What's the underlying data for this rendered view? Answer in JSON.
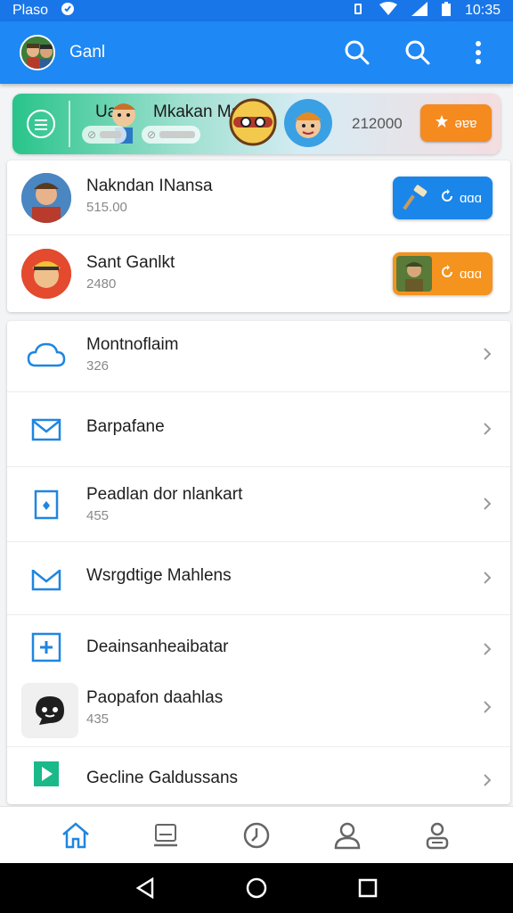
{
  "status_bar": {
    "carrier": "Plaso",
    "time": "10:35"
  },
  "app_bar": {
    "title": "Ganl",
    "icons": [
      "search-icon",
      "search-icon",
      "more-vert-icon"
    ]
  },
  "banner": {
    "title": "Mkakan Ma",
    "title_prefix": "Ua",
    "chip1": "⊘",
    "chip2": "⊘",
    "amount": "212000",
    "button_label": "ǝɐɐ",
    "button_icon": "star-icon"
  },
  "featured": [
    {
      "title": "Nakndan INansa",
      "subtitle": "515.00",
      "button_label": "ɑɑɑ",
      "button_color": "#1a86ea"
    },
    {
      "title": "Sant Ganlkt",
      "subtitle": "2480",
      "button_label": "ɑɑɑ",
      "button_color": "#f4931e"
    }
  ],
  "list": [
    {
      "title": "Montnoflaim",
      "subtitle": "326",
      "icon": "cloud-icon"
    },
    {
      "title": "Barpafane",
      "subtitle": "",
      "icon": "mail-icon"
    },
    {
      "title": "Peadlan dor nlankart",
      "subtitle": "455",
      "icon": "file-icon"
    },
    {
      "title": "Wsrgdtige Mahlens",
      "subtitle": "",
      "icon": "mail-icon"
    },
    {
      "title": "Deainsanheaibatar",
      "subtitle": "",
      "icon": "plus-box-icon"
    },
    {
      "title": "Paopafon daahlas",
      "subtitle": "435",
      "icon": "chat-icon"
    },
    {
      "title": "Gecline Galdussans",
      "subtitle": "",
      "icon": "play-icon"
    }
  ],
  "bottom_nav": [
    "home-icon",
    "laptop-icon",
    "clock-icon",
    "person-icon",
    "person-group-icon"
  ],
  "colors": {
    "primary": "#1e88f5",
    "accent_orange": "#f58a1f",
    "icon_blue": "#1f86e0",
    "play_green": "#1ab98a"
  }
}
